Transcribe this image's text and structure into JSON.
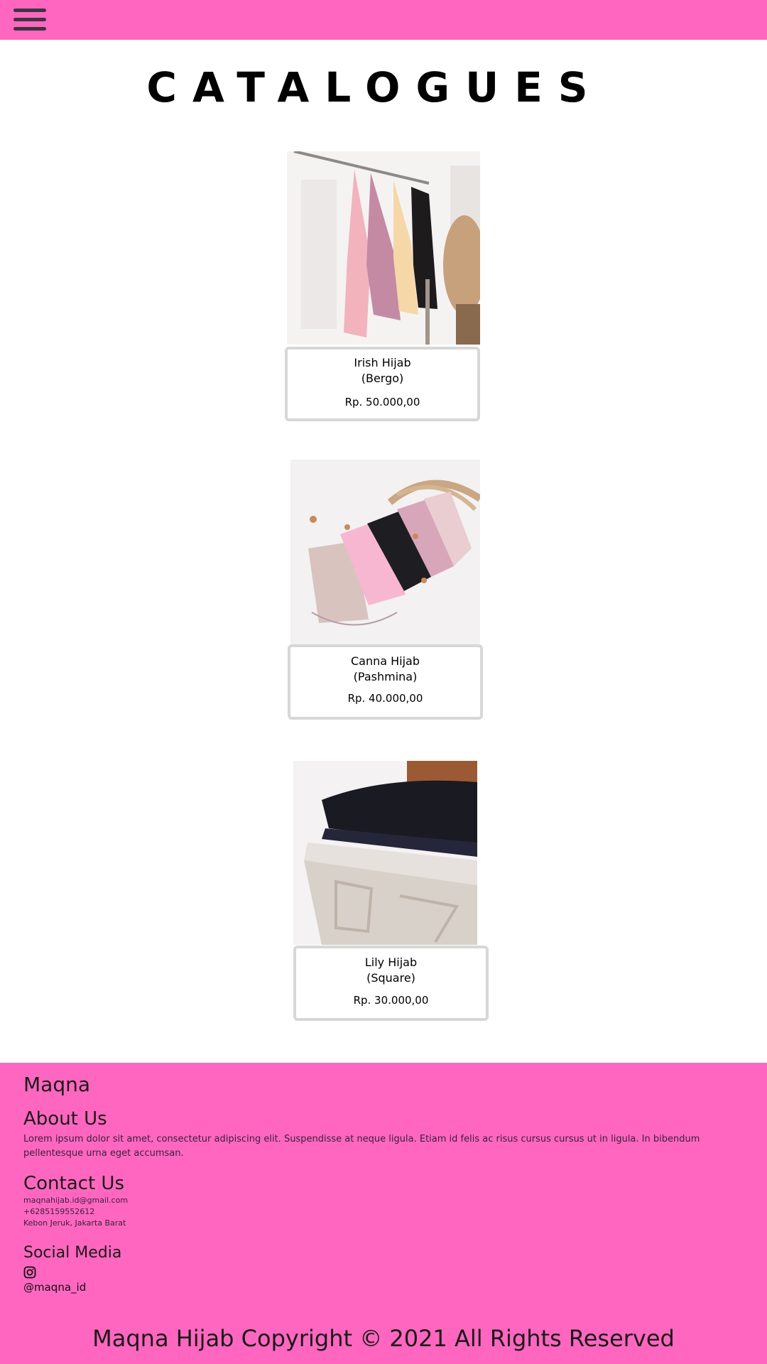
{
  "header": {
    "menu_icon": "hamburger-menu-icon",
    "background_color": "#ff66bf"
  },
  "main": {
    "title": "CATALOGUES",
    "products": [
      {
        "name_line1": "Irish Hijab",
        "name_line2": "(Bergo)",
        "price": "Rp. 50.000,00",
        "image": "hijabs-on-hanger-photo"
      },
      {
        "name_line1": "Canna Hijab",
        "name_line2": "(Pashmina)",
        "price": "Rp. 40.000,00",
        "image": "folded-pashmina-photo"
      },
      {
        "name_line1": "Lily Hijab",
        "name_line2": "(Square)",
        "price": "Rp. 30.000,00",
        "image": "stacked-square-hijab-photo"
      }
    ]
  },
  "footer": {
    "brand": "Maqna",
    "about_heading": "About Us",
    "about_text": "Lorem ipsum dolor sit amet, consectetur adipiscing elit. Suspendisse at neque ligula. Etiam id felis ac risus cursus cursus ut in ligula. In bibendum pellentesque urna eget accumsan.",
    "contact_heading": "Contact Us",
    "email": "maqnahijab.id@gmail.com",
    "phone": "+6285159552612",
    "address": "Kebon Jeruk, Jakarta Barat",
    "social_heading": "Social Media",
    "social_icon": "instagram-icon",
    "instagram": "@maqna_id",
    "copyright": "Maqna Hijab Copyright © 2021 All Rights Reserved"
  },
  "colors": {
    "accent": "#ff66bf",
    "card_border": "#d7d7d7"
  }
}
